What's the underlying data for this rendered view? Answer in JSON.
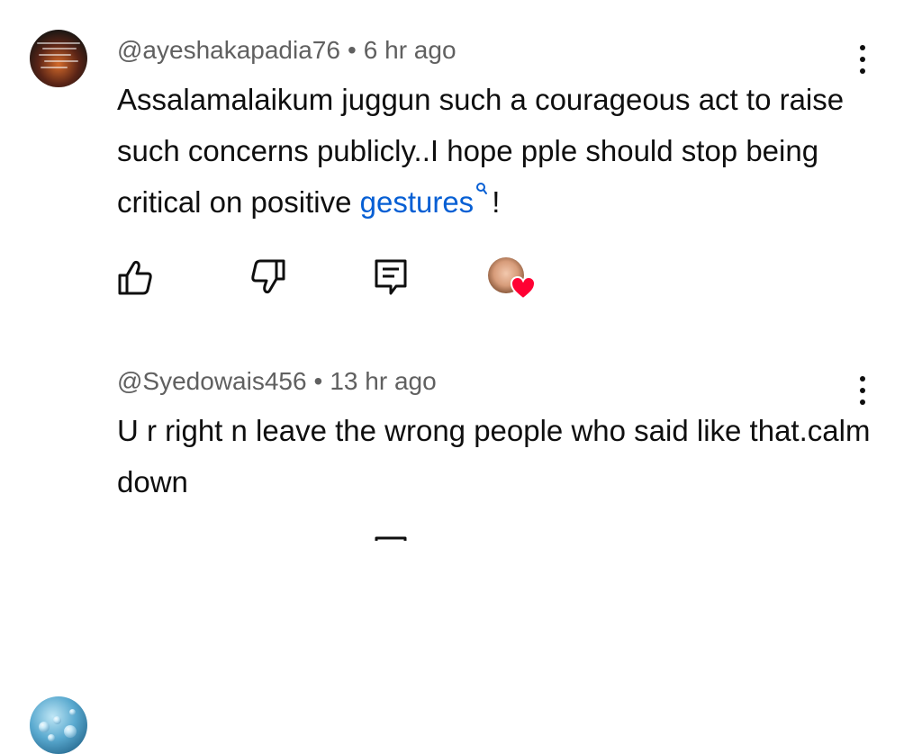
{
  "comments": [
    {
      "handle": "@ayeshakapadia76",
      "separator": "•",
      "time": "6 hr ago",
      "text_before": "Assalamalaikum juggun such a courageous act to raise such concerns publicly..I hope pple should stop being critical on positive ",
      "link_text": "gestures",
      "text_after": "!",
      "avatar_icon": "calligraphy-avatar",
      "has_creator_heart": true
    },
    {
      "handle": "@Syedowais456",
      "separator": "•",
      "time": "13 hr ago",
      "text": "U r right n leave the wrong people who said like that.calm down",
      "avatar_icon": "water-drops-avatar",
      "has_creator_heart": false
    }
  ],
  "icons": {
    "like": "thumbs-up-icon",
    "dislike": "thumbs-down-icon",
    "reply": "comment-reply-icon",
    "menu": "more-vertical-icon",
    "search": "search-icon",
    "heart": "heart-icon"
  },
  "colors": {
    "text": "#0f0f0f",
    "meta": "#606060",
    "link": "#065fd4",
    "heart": "#ff0033",
    "background": "#ffffff"
  }
}
